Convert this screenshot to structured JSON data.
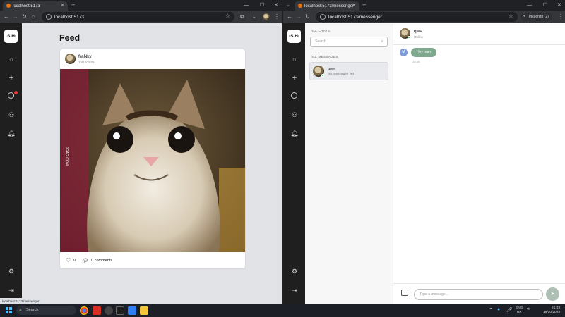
{
  "left_window": {
    "tab_title": "localhost:5173",
    "url": "localhost:5173",
    "status_url": "localhost:5173/messenger"
  },
  "right_window": {
    "tab_title": "localhost:5173/messenger",
    "url": "localhost:5173/messenger",
    "profile_label": "Incognito (2)"
  },
  "app": {
    "logo": "·S.H·",
    "sidebar_icons": [
      "home-icon",
      "plus-icon",
      "chat-icon",
      "users-icon",
      "bell-icon",
      "settings-icon",
      "logout-icon"
    ]
  },
  "feed": {
    "title": "Feed",
    "post": {
      "author": "fraNky",
      "date": "19/10/2025",
      "likes": "0",
      "comments": "0 comments",
      "image_caption": "9GAG.COM"
    }
  },
  "messenger": {
    "all_chats_label": "ALL CHATS",
    "search_placeholder": "Search",
    "all_messages_label": "ALL MESSAGES",
    "chats": [
      {
        "name": "qwe",
        "preview": "No messages yet"
      }
    ],
    "header": {
      "name": "qwe",
      "status": "Online"
    },
    "messages": [
      {
        "avatar_letter": "M",
        "text": "Hey man",
        "time": "18:05"
      }
    ],
    "input_placeholder": "Type a message..."
  },
  "taskbar": {
    "search_placeholder": "Search",
    "lang_line1": "ENG",
    "lang_line2": "UK",
    "time": "21:03",
    "date": "19/10/2025"
  },
  "colors": {
    "sidebar": "#1f1f1f",
    "feed_bg": "#e1e3e7",
    "bubble": "#7fa98f",
    "online": "#2fbf71",
    "badge": "#e53935"
  }
}
